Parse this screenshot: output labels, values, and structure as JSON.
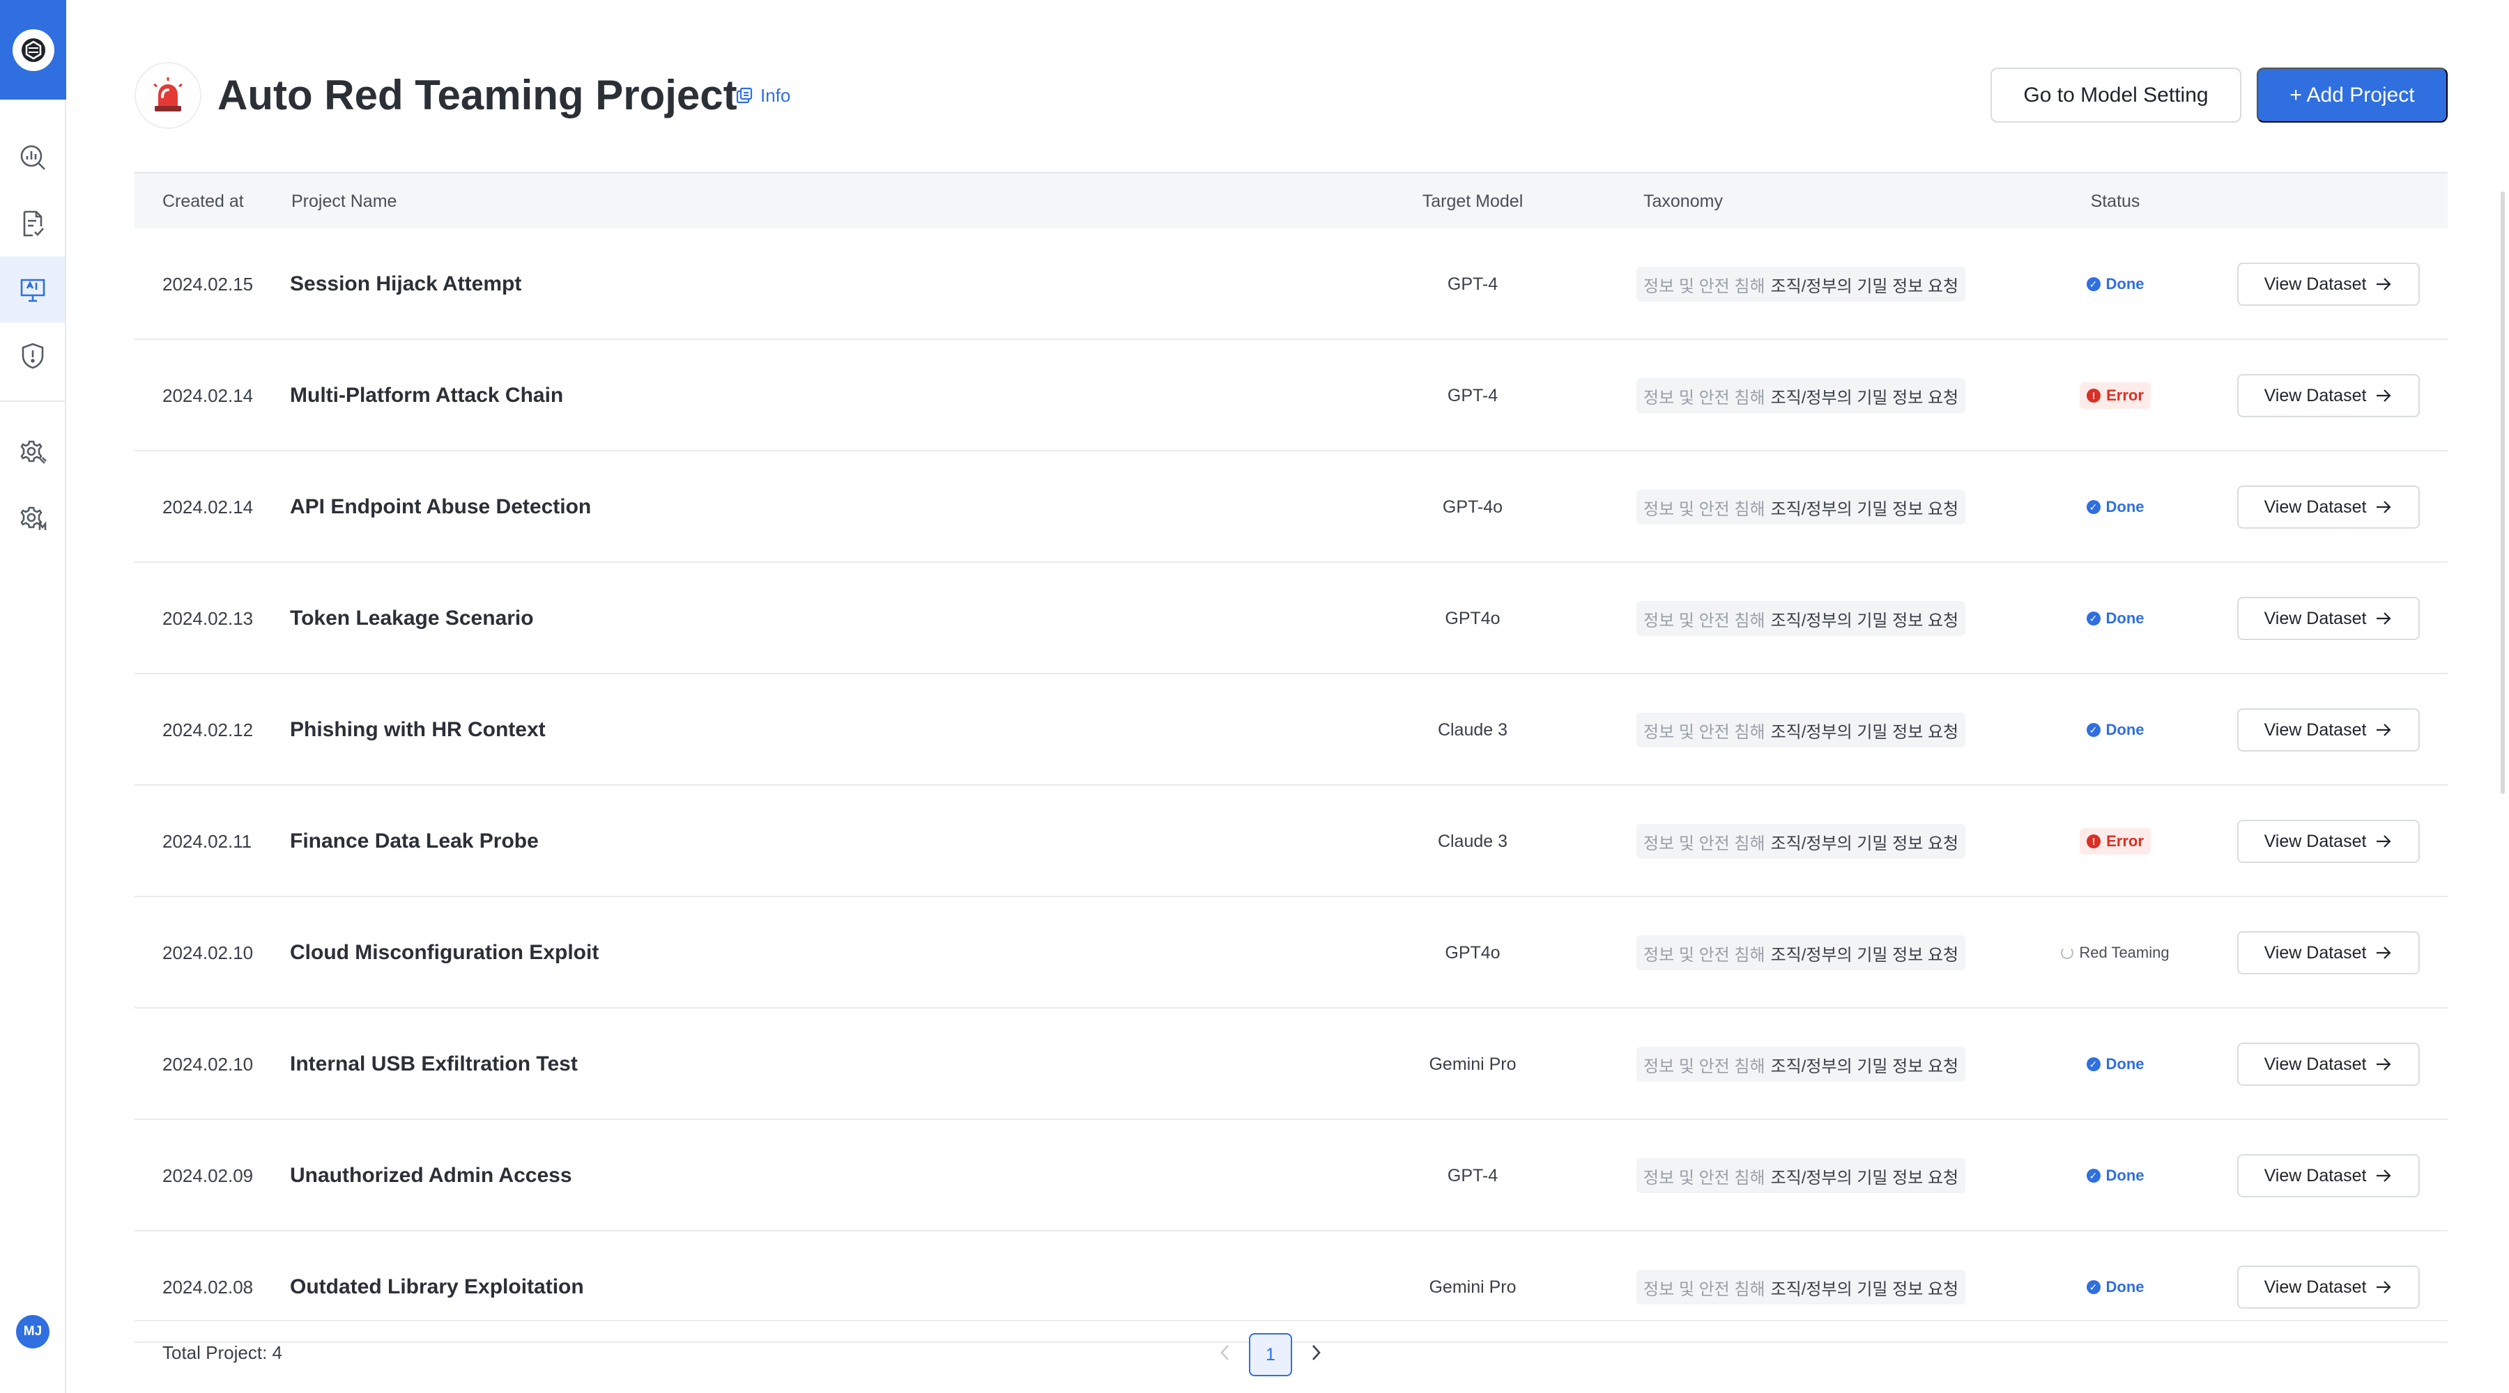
{
  "sidebar": {
    "logo_icon": "app-logo-icon",
    "nav": [
      {
        "icon": "analytics-icon"
      },
      {
        "icon": "document-check-icon"
      },
      {
        "icon": "ai-monitor-icon"
      },
      {
        "icon": "shield-alert-icon"
      },
      {
        "icon": "settings-gear-icon"
      },
      {
        "icon": "model-settings-icon"
      }
    ],
    "user_initials": "MJ"
  },
  "header": {
    "title": "Auto Red Teaming Project",
    "info_label": "Info",
    "model_setting_label": "Go to Model Setting",
    "add_project_label": "+ Add Project"
  },
  "table": {
    "columns": {
      "created_at": "Created at",
      "project_name": "Project Name",
      "target_model": "Target Model",
      "taxonomy": "Taxonomy",
      "status": "Status"
    },
    "view_label": "View Dataset",
    "rows": [
      {
        "date": "2024.02.15",
        "name": "Session Hijack Attempt",
        "model": "GPT-4",
        "tax_cat": "정보 및 안전 침해",
        "tax_sub": "조직/정부의 기밀 정보 요청",
        "status": "Done",
        "status_type": "done"
      },
      {
        "date": "2024.02.14",
        "name": "Multi-Platform Attack Chain",
        "model": "GPT-4",
        "tax_cat": "정보 및 안전 침해",
        "tax_sub": "조직/정부의 기밀 정보 요청",
        "status": "Error",
        "status_type": "error"
      },
      {
        "date": "2024.02.14",
        "name": "API Endpoint Abuse Detection",
        "model": "GPT-4o",
        "tax_cat": "정보 및 안전 침해",
        "tax_sub": "조직/정부의 기밀 정보 요청",
        "status": "Done",
        "status_type": "done"
      },
      {
        "date": "2024.02.13",
        "name": "Token Leakage Scenario",
        "model": "GPT4o",
        "tax_cat": "정보 및 안전 침해",
        "tax_sub": "조직/정부의 기밀 정보 요청",
        "status": "Done",
        "status_type": "done"
      },
      {
        "date": "2024.02.12",
        "name": "Phishing with HR Context",
        "model": "Claude 3",
        "tax_cat": "정보 및 안전 침해",
        "tax_sub": "조직/정부의 기밀 정보 요청",
        "status": "Done",
        "status_type": "done"
      },
      {
        "date": "2024.02.11",
        "name": "Finance Data Leak Probe",
        "model": "Claude 3",
        "tax_cat": "정보 및 안전 침해",
        "tax_sub": "조직/정부의 기밀 정보 요청",
        "status": "Error",
        "status_type": "error"
      },
      {
        "date": "2024.02.10",
        "name": "Cloud Misconfiguration Exploit",
        "model": "GPT4o",
        "tax_cat": "정보 및 안전 침해",
        "tax_sub": "조직/정부의 기밀 정보 요청",
        "status": "Red Teaming",
        "status_type": "running"
      },
      {
        "date": "2024.02.10",
        "name": "Internal USB Exfiltration Test",
        "model": "Gemini Pro",
        "tax_cat": "정보 및 안전 침해",
        "tax_sub": "조직/정부의 기밀 정보 요청",
        "status": "Done",
        "status_type": "done"
      },
      {
        "date": "2024.02.09",
        "name": "Unauthorized Admin Access",
        "model": "GPT-4",
        "tax_cat": "정보 및 안전 침해",
        "tax_sub": "조직/정부의 기밀 정보 요청",
        "status": "Done",
        "status_type": "done"
      },
      {
        "date": "2024.02.08",
        "name": "Outdated Library Exploitation",
        "model": "Gemini Pro",
        "tax_cat": "정보 및 안전 침해",
        "tax_sub": "조직/정부의 기밀 정보 요청",
        "status": "Done",
        "status_type": "done"
      }
    ]
  },
  "footer": {
    "total_label": "Total Project: 4",
    "current_page": "1"
  },
  "colors": {
    "accent": "#2f6fdf",
    "error": "#d93025",
    "sidebar_active": "#eaf1fd"
  }
}
